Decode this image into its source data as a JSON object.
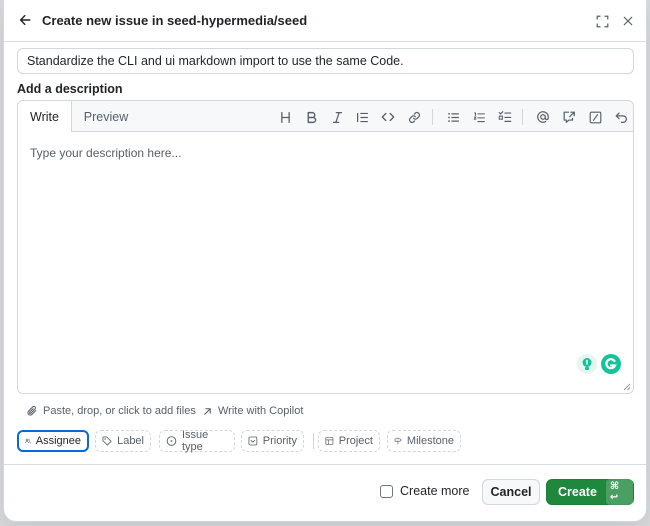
{
  "header": {
    "title": "Create new issue in seed-hypermedia/seed"
  },
  "issue_title": {
    "value": "Standardize the CLI and ui markdown import to use the same Code."
  },
  "description": {
    "label": "Add a description",
    "tabs": [
      "Write",
      "Preview"
    ],
    "active_tab": "Write",
    "placeholder": "Type your description here..."
  },
  "toolbar_icons": [
    "heading-icon",
    "bold-icon",
    "italic-icon",
    "quote-icon",
    "code-icon",
    "link-icon",
    "unordered-list-icon",
    "ordered-list-icon",
    "task-list-icon",
    "mention-icon",
    "cross-reference-icon",
    "slash-command-icon",
    "undo-icon"
  ],
  "attach": {
    "label": "Paste, drop, or click to add files",
    "copilot_label": "Write with Copilot"
  },
  "metadata_chips": {
    "assignee": "Assignee",
    "label": "Label",
    "issue_type": "Issue type",
    "priority": "Priority",
    "project": "Project",
    "milestone": "Milestone"
  },
  "footer": {
    "create_more": "Create more",
    "cancel": "Cancel",
    "create": "Create",
    "shortcut": "⌘ ↩"
  },
  "colors": {
    "primary": "#1f883d",
    "focus": "#0969da",
    "border": "#d0d7de"
  }
}
